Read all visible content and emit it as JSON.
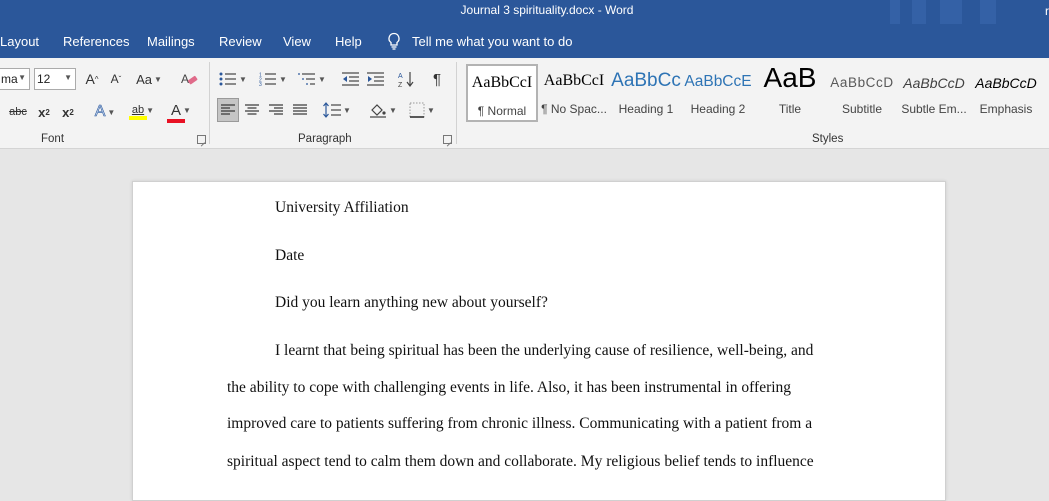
{
  "title_bar": {
    "title": "Journal 3 spirituality.docx  -  Word",
    "user_initial": "r"
  },
  "tabs": [
    "Layout",
    "References",
    "Mailings",
    "Review",
    "View",
    "Help"
  ],
  "tell_me": {
    "text": "Tell me what you want to do",
    "icon": "lightbulb-icon"
  },
  "font_group": {
    "label": "Font",
    "font_name": "ma",
    "font_size": "12",
    "grow_glyph": "A",
    "shrink_glyph": "A",
    "change_case_label": "Aa",
    "strike_label": "abc",
    "subscript_label": "x",
    "subscript_mark": "2",
    "superscript_label": "x",
    "superscript_mark": "2",
    "text_effects_glyph": "A",
    "highlight_glyph": "ab",
    "font_color_glyph": "A",
    "highlight_color": "#ffff00",
    "font_color": "#e81123"
  },
  "paragraph_group": {
    "label": "Paragraph"
  },
  "styles_group": {
    "label": "Styles",
    "items": [
      {
        "preview": "AaBbCcI",
        "label": "¶ Normal",
        "color": "#000000"
      },
      {
        "preview": "AaBbCcI",
        "label": "¶ No Spac...",
        "color": "#000000"
      },
      {
        "preview": "AaBbCc",
        "label": "Heading 1",
        "color": "#2e74b5"
      },
      {
        "preview": "AaBbCcE",
        "label": "Heading 2",
        "color": "#2e74b5"
      },
      {
        "preview": "AaB",
        "label": "Title",
        "color": "#000000"
      },
      {
        "preview": "AaBbCcD",
        "label": "Subtitle",
        "color": "#595959"
      },
      {
        "preview": "AaBbCcD",
        "label": "Subtle Em...",
        "color": "#404040"
      },
      {
        "preview": "AaBbCcD",
        "label": "Emphasis",
        "color": "#000000"
      }
    ]
  },
  "document": {
    "lines": [
      "University Affiliation",
      "Date",
      "Did you learn anything new about yourself?",
      "I learnt that being spiritual has been the underlying cause of resilience, well-being, and",
      "the ability to cope with challenging events in life. Also, it has been instrumental in offering",
      "improved care to patients suffering from chronic illness. Communicating with a patient from a",
      "spiritual aspect tend to calm them down and collaborate. My religious belief tends to influence"
    ]
  },
  "colors": {
    "ribbon_blue": "#2b579a",
    "ribbon_bg": "#f3f3f3",
    "doc_bg": "#e6e6e6"
  }
}
